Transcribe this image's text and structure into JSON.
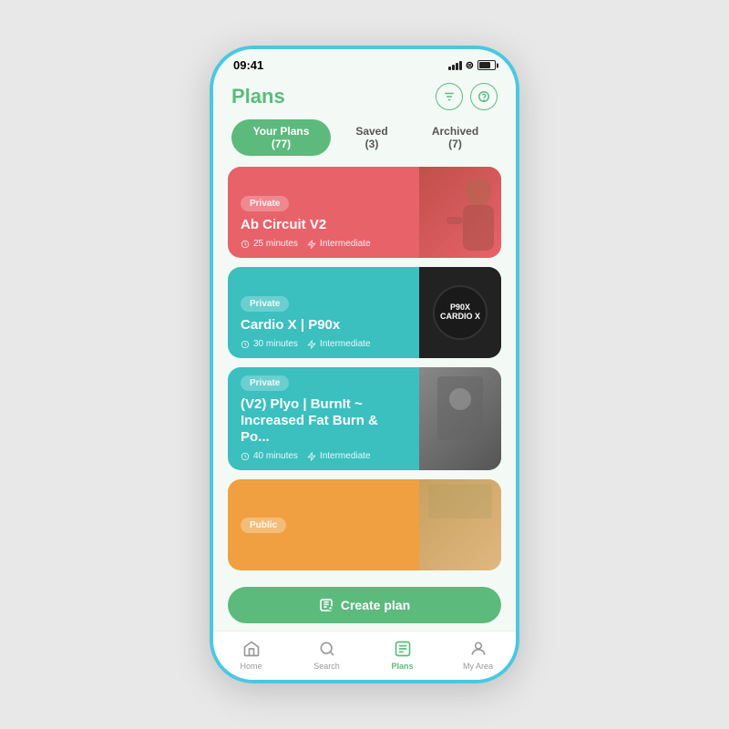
{
  "statusBar": {
    "time": "09:41"
  },
  "header": {
    "title": "Plans",
    "filterLabel": "filter",
    "helpLabel": "help"
  },
  "tabs": [
    {
      "label": "Your Plans (77)",
      "active": true
    },
    {
      "label": "Saved (3)",
      "active": false
    },
    {
      "label": "Archived (7)",
      "active": false
    }
  ],
  "plans": [
    {
      "badge": "Private",
      "title": "Ab Circuit V2",
      "duration": "25 minutes",
      "level": "Intermediate",
      "color": "red"
    },
    {
      "badge": "Private",
      "title": "Cardio X | P90x",
      "duration": "30 minutes",
      "level": "Intermediate",
      "color": "teal"
    },
    {
      "badge": "Private",
      "title": "(V2) Plyo | BurnIt ~ Increased Fat Burn & Po...",
      "duration": "40 minutes",
      "level": "Intermediate",
      "color": "teal"
    },
    {
      "badge": "Public",
      "title": "",
      "duration": "",
      "level": "",
      "color": "orange",
      "partial": true
    }
  ],
  "createPlanBtn": "Create plan",
  "bottomNav": [
    {
      "label": "Home",
      "icon": "⊞",
      "active": false
    },
    {
      "label": "Search",
      "icon": "⌕",
      "active": false
    },
    {
      "label": "Plans",
      "icon": "📋",
      "active": true
    },
    {
      "label": "My Area",
      "icon": "⊙",
      "active": false
    }
  ]
}
